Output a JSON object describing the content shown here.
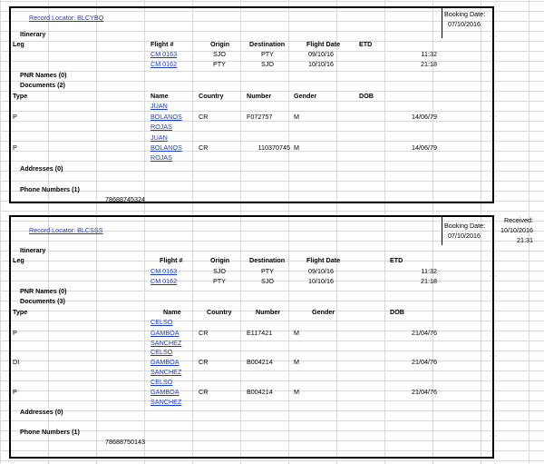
{
  "records": [
    {
      "locator": "Record Locator: BLCYBQ",
      "booking_label": "Booking Date:",
      "booking_date": "07/10/2016",
      "itinerary": "Itinerary",
      "leg_header": "Leg",
      "flight_headers": [
        "Flight #",
        "Origin",
        "Destination",
        "Flight Date",
        "ETD"
      ],
      "flights": [
        {
          "flight": "CM 0163",
          "origin": "SJO",
          "dest": "PTY",
          "date": "09/10/16",
          "etd": "11:32"
        },
        {
          "flight": "CM 0162",
          "origin": "PTY",
          "dest": "SJO",
          "date": "10/10/16",
          "etd": "21:18"
        }
      ],
      "pnr_names": "PNR Names (0)",
      "documents": "Documents (2)",
      "doc_headers": [
        "Type",
        "Name",
        "Country",
        "Number",
        "Gender",
        "DOB"
      ],
      "docs": [
        {
          "type": "P",
          "name": [
            "JUAN",
            "BOLANOS",
            "ROJAS"
          ],
          "country": "CR",
          "number": "F072757",
          "gender": "M",
          "dob": "14/06/79"
        },
        {
          "type": "P",
          "name": [
            "JUAN",
            "BOLANOS",
            "ROJAS"
          ],
          "country": "CR",
          "number": "110370745",
          "gender": "M",
          "dob": "14/06/79"
        }
      ],
      "addresses": "Addresses (0)",
      "phones": "Phone Numbers (1)",
      "phone": "78688745324"
    },
    {
      "locator": "Record Locator: BLCSSS",
      "booking_label": "Booking Date:",
      "booking_date": "07/10/2016",
      "received_label": "Received:",
      "received_date": "10/10/2016",
      "received_time": "21:31",
      "itinerary": "Itinerary",
      "leg_header": "Leg",
      "flight_headers": [
        "Flight #",
        "Origin",
        "Destination",
        "Flight Date",
        "ETD"
      ],
      "flights": [
        {
          "flight": "CM 0163",
          "origin": "SJO",
          "dest": "PTY",
          "date": "09/10/16",
          "etd": "11:32"
        },
        {
          "flight": "CM 0162",
          "origin": "PTY",
          "dest": "SJO",
          "date": "10/10/16",
          "etd": "21:18"
        }
      ],
      "pnr_names": "PNR Names (0)",
      "documents": "Documents (3)",
      "doc_headers": [
        "Type",
        "Name",
        "Country",
        "Number",
        "Gender",
        "DOB"
      ],
      "docs": [
        {
          "type": "P",
          "name": [
            "CELSO",
            "GAMBOA",
            "SANCHEZ"
          ],
          "country": "CR",
          "number": "E117421",
          "gender": "M",
          "dob": "21/04/76"
        },
        {
          "type": "DI",
          "name": [
            "CELSO",
            "GAMBOA",
            "SANCHEZ"
          ],
          "country": "CR",
          "number": "B004214",
          "gender": "M",
          "dob": "21/04/76"
        },
        {
          "type": "P",
          "name": [
            "CELSO",
            "GAMBOA",
            "SANCHEZ"
          ],
          "country": "CR",
          "number": "B004214",
          "gender": "M",
          "dob": "21/04/76"
        }
      ],
      "addresses": "Addresses (0)",
      "phones": "Phone Numbers (1)",
      "phone": "78688750143"
    }
  ]
}
